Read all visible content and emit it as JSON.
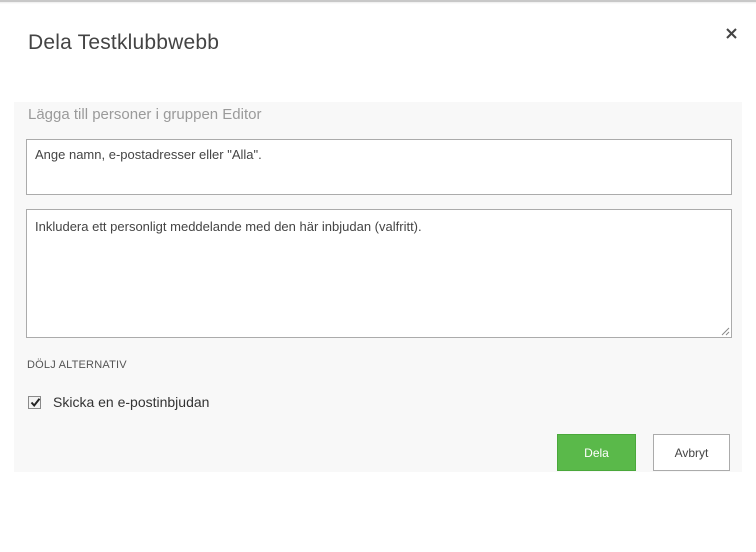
{
  "dialog": {
    "title": "Dela Testklubbwebb",
    "close_icon": "close-icon"
  },
  "share": {
    "section_label": "Lägga till personer i gruppen Editor",
    "people_placeholder": "Ange namn, e-postadresser eller \"Alla\".",
    "message_placeholder": "Inkludera ett personligt meddelande med den här inbjudan (valfritt)."
  },
  "options": {
    "toggle_label": "DÖLJ ALTERNATIV",
    "send_email_label": "Skicka en e-postinbjudan",
    "send_email_checked": true
  },
  "buttons": {
    "share_label": "Dela",
    "cancel_label": "Avbryt"
  },
  "colors": {
    "primary_button": "#5ab94a",
    "label_gray": "#9a9a9a"
  }
}
